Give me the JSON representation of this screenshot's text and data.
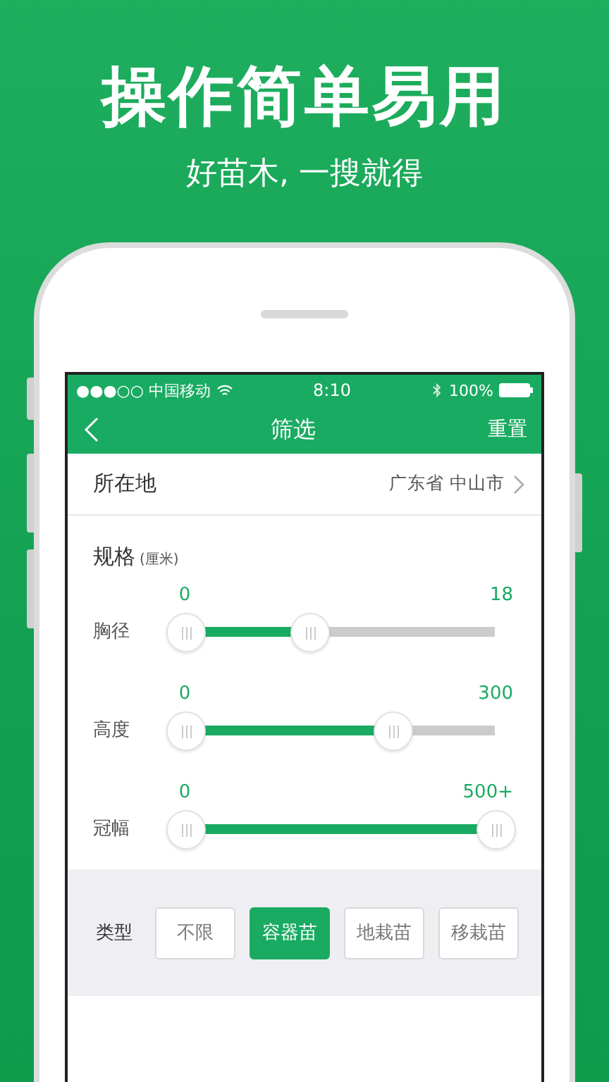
{
  "promo": {
    "title": "操作简单易用",
    "subtitle": "好苗木, 一搜就得"
  },
  "status_bar": {
    "carrier": "●●●○○ 中国移动",
    "time": "8:10",
    "battery": "100%"
  },
  "nav": {
    "title": "筛选",
    "action": "重置"
  },
  "location": {
    "label": "所在地",
    "value": "广东省 中山市"
  },
  "specs": {
    "title": "规格",
    "unit": "(厘米)",
    "sliders": [
      {
        "name": "胸径",
        "min_label": "0",
        "max_label": "18",
        "level": 0.4
      },
      {
        "name": "高度",
        "min_label": "0",
        "max_label": "300",
        "level": 0.67
      },
      {
        "name": "冠幅",
        "min_label": "0",
        "max_label": "500+",
        "level": 1
      }
    ]
  },
  "type_filter": {
    "label": "类型",
    "options": [
      {
        "label": "不限",
        "selected": false
      },
      {
        "label": "容器苗",
        "selected": true
      },
      {
        "label": "地栽苗",
        "selected": false
      },
      {
        "label": "移栽苗",
        "selected": false
      }
    ]
  }
}
